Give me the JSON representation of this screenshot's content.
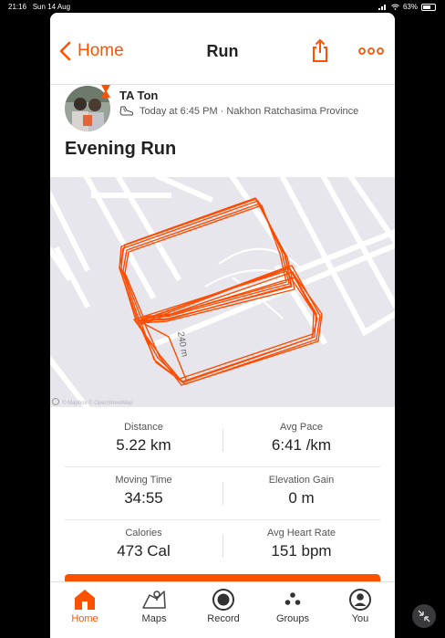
{
  "status_bar": {
    "time": "21:16",
    "date": "Sun 14 Aug",
    "battery": "63%",
    "battery_level": 0.63
  },
  "nav": {
    "back_label": "Home",
    "title": "Run",
    "share_icon": "share-icon",
    "more_icon": "more-icon"
  },
  "athlete": {
    "name": "TA Ton",
    "timestamp": "Today at 6:45 PM · Nakhon Ratchasima Province",
    "activity_icon": "shoe-icon"
  },
  "activity": {
    "title": "Evening Run"
  },
  "map": {
    "scale_label": "240 m",
    "attribution": "© Mapbox © OpenStreetMap"
  },
  "stats": [
    {
      "left": {
        "label": "Distance",
        "value": "5.22 km"
      },
      "right": {
        "label": "Avg Pace",
        "value": "6:41 /km"
      }
    },
    {
      "left": {
        "label": "Moving Time",
        "value": "34:55"
      },
      "right": {
        "label": "Elevation Gain",
        "value": "0 m"
      }
    },
    {
      "left": {
        "label": "Calories",
        "value": "473 Cal"
      },
      "right": {
        "label": "Avg Heart Rate",
        "value": "151 bpm"
      }
    }
  ],
  "tabs": [
    {
      "label": "Home",
      "icon": "home-icon",
      "active": true
    },
    {
      "label": "Maps",
      "icon": "maps-icon",
      "active": false
    },
    {
      "label": "Record",
      "icon": "record-icon",
      "active": false
    },
    {
      "label": "Groups",
      "icon": "groups-icon",
      "active": false
    },
    {
      "label": "You",
      "icon": "you-icon",
      "active": false
    }
  ],
  "colors": {
    "accent": "#fc5200",
    "route": "#fc4c02",
    "map_background": "#e6e6ec",
    "road": "#ffffff"
  }
}
